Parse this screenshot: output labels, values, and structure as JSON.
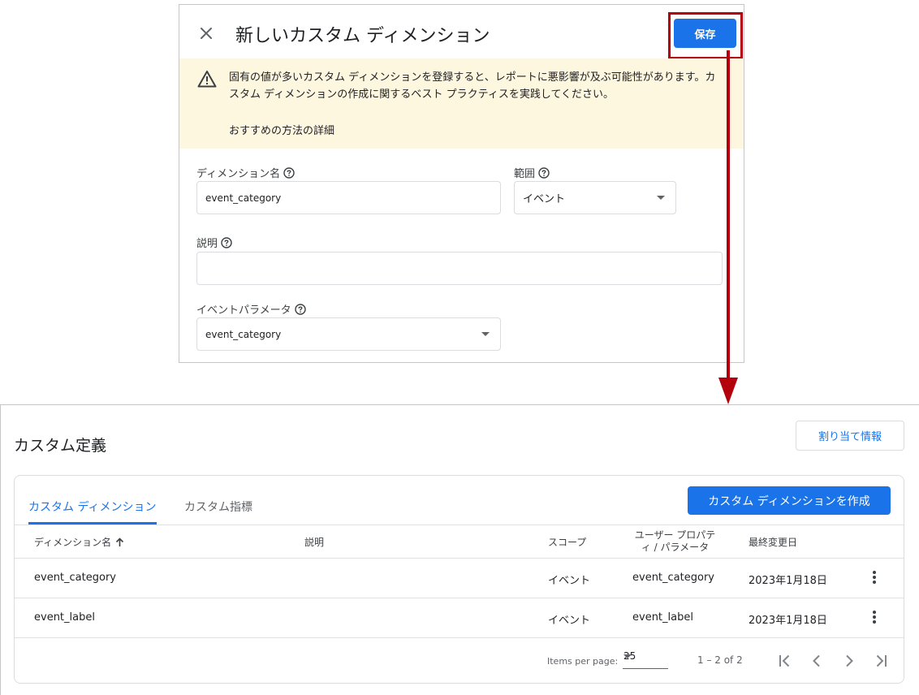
{
  "dialog": {
    "title": "新しいカスタム ディメンション",
    "save_label": "保存",
    "warning_text": "固有の値が多いカスタム ディメンションを登録すると、レポートに悪影響が及ぶ可能性があります。カスタム ディメンションの作成に関するベスト プラクティスを実践してください。",
    "warning_link": "おすすめの方法の詳細",
    "dimension_name_label": "ディメンション名",
    "dimension_name_value": "event_category",
    "scope_label": "範囲",
    "scope_value": "イベント",
    "description_label": "説明",
    "description_value": "",
    "event_param_label": "イベントパラメータ",
    "event_param_value": "event_category"
  },
  "annotation": {
    "highlight_color": "#b3000c"
  },
  "panel": {
    "title": "カスタム定義",
    "assign_button": "割り当て情報",
    "tabs": [
      {
        "label": "カスタム ディメンション",
        "active": true
      },
      {
        "label": "カスタム指標",
        "active": false
      }
    ],
    "create_button": "カスタム ディメンションを作成",
    "columns": {
      "name": "ディメンション名",
      "description": "説明",
      "scope": "スコープ",
      "user_prop_line1": "ユーザー プロパテ",
      "user_prop_line2": "ィ / パラメータ",
      "modified": "最終変更日"
    },
    "rows": [
      {
        "name": "event_category",
        "description": "",
        "scope": "イベント",
        "param": "event_category",
        "modified": "2023年1月18日"
      },
      {
        "name": "event_label",
        "description": "",
        "scope": "イベント",
        "param": "event_label",
        "modified": "2023年1月18日"
      }
    ],
    "pagination": {
      "items_per_page_label": "Items per page:",
      "items_per_page": "25",
      "range": "1 – 2 of 2"
    }
  },
  "colors": {
    "primary": "#1a73e8",
    "warning_bg": "#fef7e0",
    "annotation_red": "#b3000c"
  }
}
